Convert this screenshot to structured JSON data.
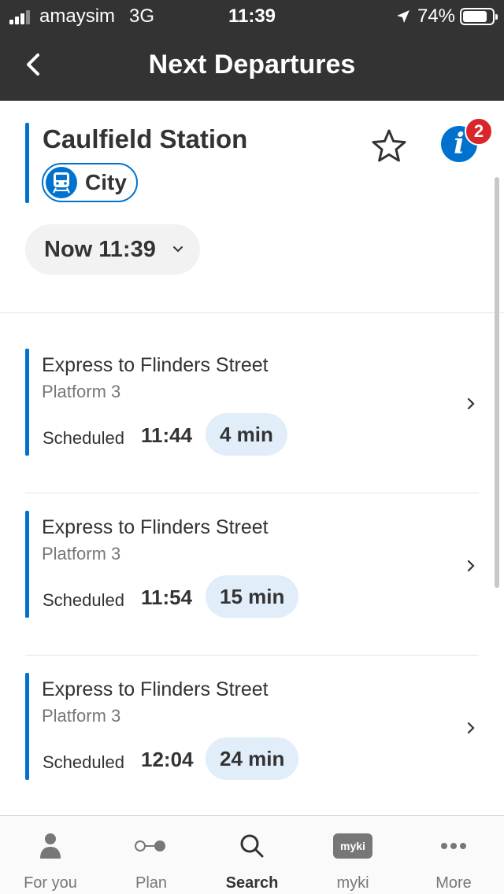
{
  "status_bar": {
    "carrier": "amaysim",
    "network": "3G",
    "time": "11:39",
    "battery": "74%",
    "icons": [
      "signal-icon",
      "location-arrow-icon",
      "battery-icon"
    ]
  },
  "nav": {
    "title": "Next Departures",
    "back_icon": "chevron-left-icon"
  },
  "stop": {
    "name": "Caulfield Station",
    "direction": "City",
    "mode_icon": "train-icon",
    "favourite_icon": "star-outline-icon",
    "info_icon": "info-icon",
    "info_badge": "2"
  },
  "time_picker": {
    "label": "Now 11:39",
    "icon": "chevron-down-icon"
  },
  "departures": [
    {
      "destination": "Express to Flinders Street",
      "platform": "Platform 3",
      "scheduled_label": "Scheduled",
      "time": "11:44",
      "minutes": "4 min"
    },
    {
      "destination": "Express to Flinders Street",
      "platform": "Platform 3",
      "scheduled_label": "Scheduled",
      "time": "11:54",
      "minutes": "15 min"
    },
    {
      "destination": "Express to Flinders Street",
      "platform": "Platform 3",
      "scheduled_label": "Scheduled",
      "time": "12:04",
      "minutes": "24 min"
    }
  ],
  "tabs": [
    {
      "label": "For you",
      "icon": "person-icon",
      "active": false
    },
    {
      "label": "Plan",
      "icon": "route-icon",
      "active": false
    },
    {
      "label": "Search",
      "icon": "search-icon",
      "active": true
    },
    {
      "label": "myki",
      "icon": "myki-card-icon",
      "active": false,
      "chip_text": "myki"
    },
    {
      "label": "More",
      "icon": "more-dots-icon",
      "active": false
    }
  ],
  "colors": {
    "header_bg": "#333333",
    "accent_blue": "#0072ce",
    "countdown_bg": "#e1eef9",
    "badge_red": "#d9262b"
  }
}
